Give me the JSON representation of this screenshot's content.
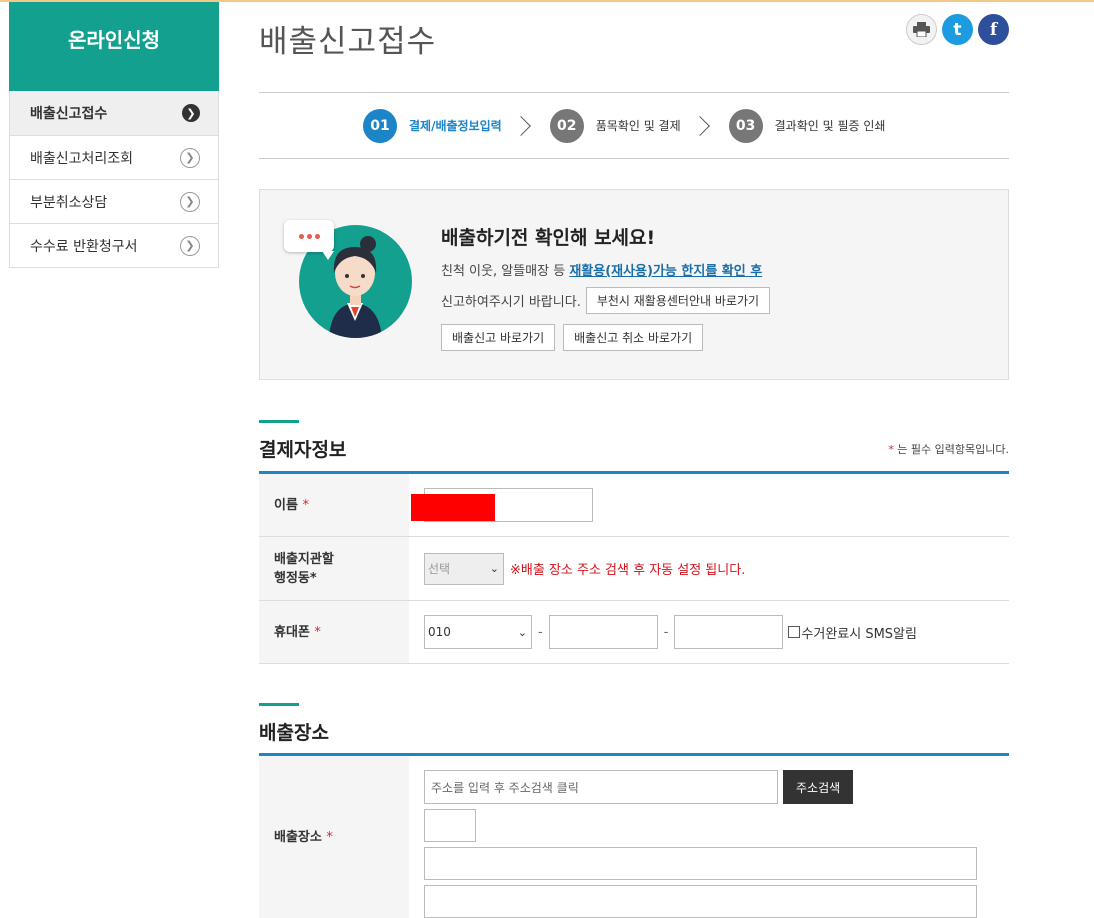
{
  "sidebar": {
    "title": "온라인신청",
    "items": [
      {
        "label": "배출신고접수",
        "active": true
      },
      {
        "label": "배출신고처리조회",
        "active": false
      },
      {
        "label": "부분취소상담",
        "active": false
      },
      {
        "label": "수수료 반환청구서",
        "active": false
      }
    ]
  },
  "page": {
    "title": "배출신고접수"
  },
  "share_icons": [
    "print-icon",
    "twitter-icon",
    "facebook-icon"
  ],
  "steps": [
    {
      "num": "01",
      "label": "결제/배출정보입력",
      "active": true
    },
    {
      "num": "02",
      "label": "품목확인 및 결제",
      "active": false
    },
    {
      "num": "03",
      "label": "결과확인 및 필증 인쇄",
      "active": false
    }
  ],
  "notice": {
    "title": "배출하기전 확인해 보세요!",
    "line1_prefix": "친척 이웃, 알뜰매장 등 ",
    "line1_link": "재활용(재사용)가능 한지를 확인 후",
    "line2_text": "신고하여주시기 바랍니다.",
    "recycle_center_btn": "부천시 재활용센터안내 바로가기",
    "report_btn": "배출신고 바로가기",
    "cancel_btn": "배출신고 취소 바로가기"
  },
  "payer_section": {
    "title": "결제자정보",
    "required_note_star": "*",
    "required_note": " 는 필수 입력항목입니다.",
    "name_label": "이름",
    "district_label_line1": "배출지관할",
    "district_label_line2": "행정동*",
    "district_select_value": "선택",
    "district_warning": "※배출 장소 주소 검색 후 자동 설정 됩니다.",
    "phone_label": "휴대폰",
    "phone_prefix": "010",
    "dash": "-",
    "sms_label": "수거완료시 SMS알림"
  },
  "place_section": {
    "title": "배출장소",
    "place_label": "배출장소",
    "address_placeholder": "주소를 입력 후 주소검색 클릭",
    "search_btn": "주소검색"
  },
  "star": "*",
  "colors": {
    "brand_green": "#13a08e",
    "accent_blue": "#1b85c7",
    "warning_red": "#d4121a"
  }
}
